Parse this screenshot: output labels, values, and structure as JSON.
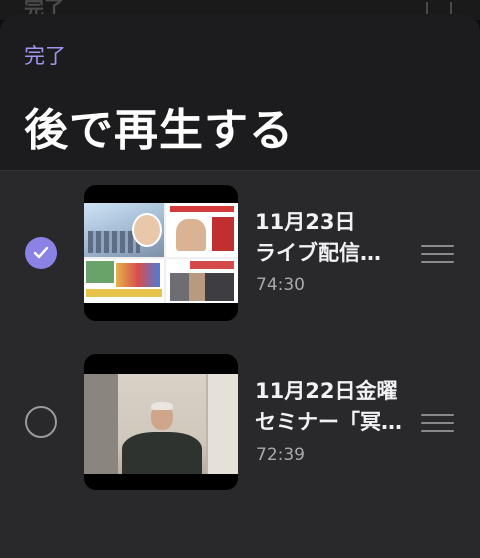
{
  "behind": {
    "label": "完了"
  },
  "header": {
    "done_label": "完了",
    "title": "後で再生する"
  },
  "items": [
    {
      "title_line1": "11月23日",
      "title_line2": "ライブ配信…",
      "duration": "74:30",
      "selected": true
    },
    {
      "title_line1": "11月22日金曜",
      "title_line2": "セミナー「冥…",
      "duration": "72:39",
      "selected": false
    }
  ],
  "colors": {
    "accent": "#8b82e6",
    "done_text": "#9f97ef",
    "sheet_bg": "#1c1c1e",
    "list_bg": "#29292b"
  },
  "icons": {
    "checkmark": "checkmark-icon",
    "reorder": "reorder-handle-icon"
  }
}
